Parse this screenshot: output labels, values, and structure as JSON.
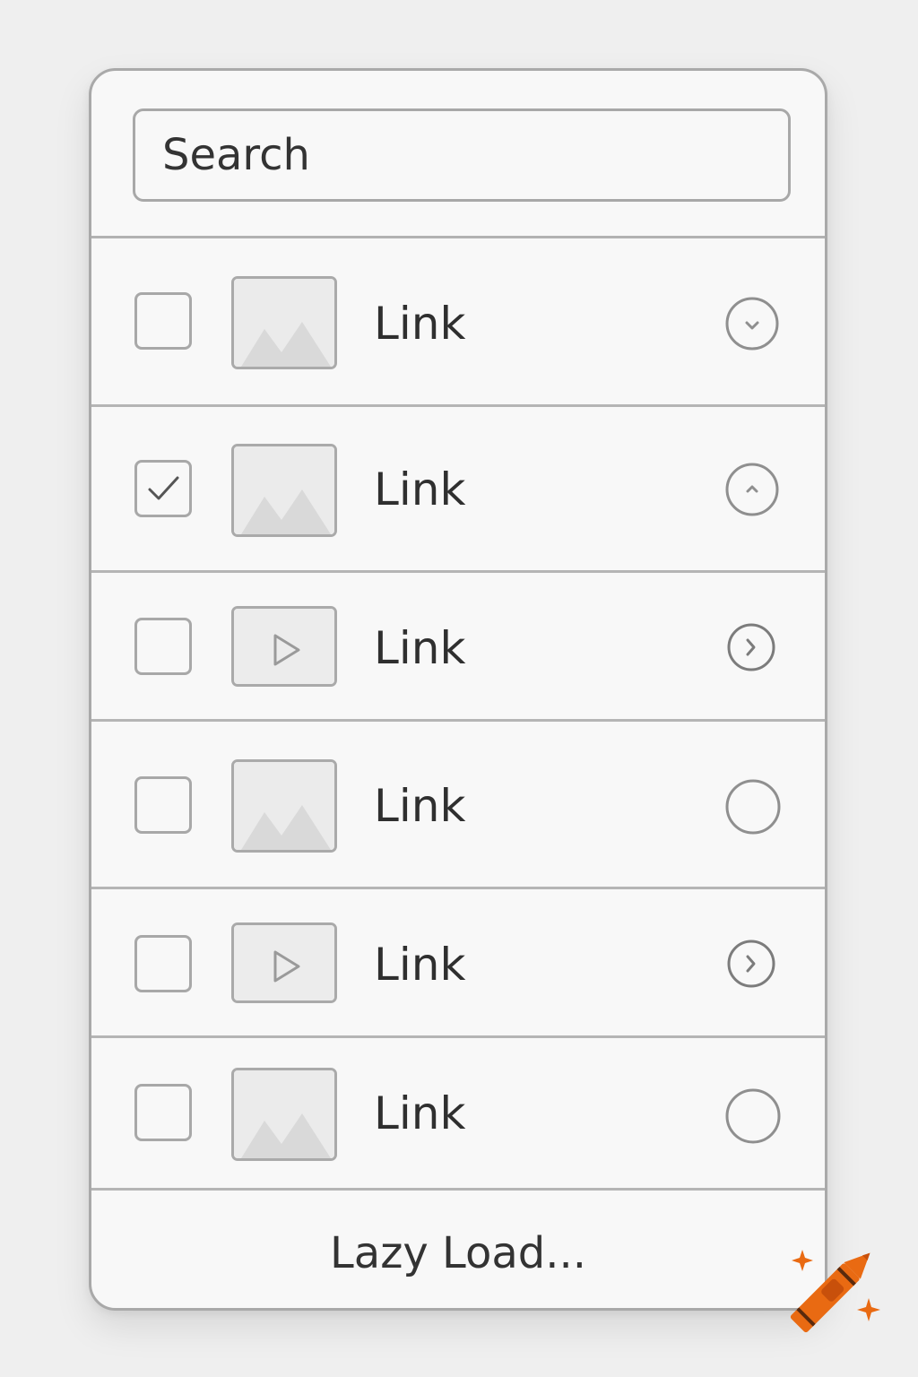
{
  "search": {
    "placeholder": "Search"
  },
  "rows": [
    {
      "label": "Link",
      "checked": false,
      "thumb": "image",
      "action": "chevron-down"
    },
    {
      "label": "Link",
      "checked": true,
      "thumb": "image",
      "action": "chevron-up"
    },
    {
      "label": "Link",
      "checked": false,
      "thumb": "video",
      "action": "chevron-right"
    },
    {
      "label": "Link",
      "checked": false,
      "thumb": "image",
      "action": "empty"
    },
    {
      "label": "Link",
      "checked": false,
      "thumb": "video",
      "action": "chevron-right"
    },
    {
      "label": "Link",
      "checked": false,
      "thumb": "image",
      "action": "empty"
    }
  ],
  "footer": {
    "label": "Lazy Load..."
  },
  "colors": {
    "border": "#a8a8a8",
    "text": "#2f2f2f",
    "card": "#f8f8f8",
    "background": "#efefef",
    "accent": "#e96a12"
  }
}
